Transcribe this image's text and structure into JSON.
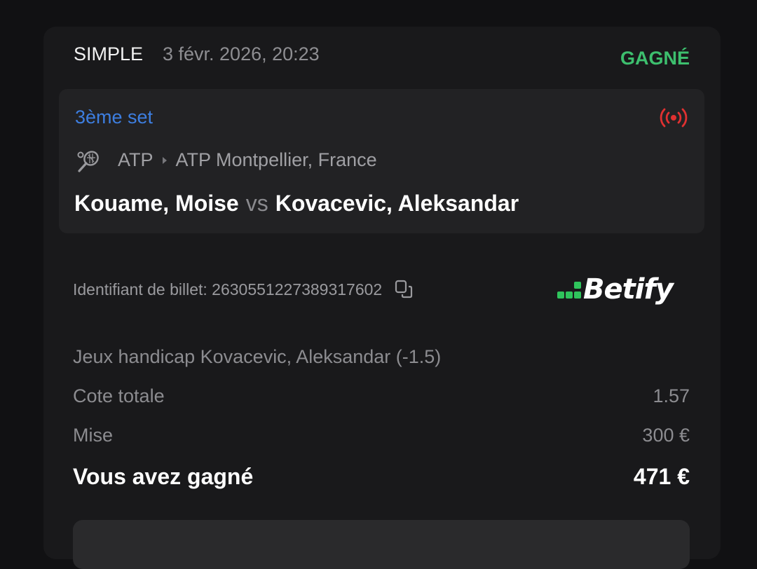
{
  "bet": {
    "type": "SIMPLE",
    "date": "3 févr. 2026, 20:23",
    "status": "GAGNÉ"
  },
  "event": {
    "status": "3ème set",
    "sport_icon": "tennis-icon",
    "live_icon": "live-broadcast-icon",
    "category": "ATP",
    "tournament": "ATP Montpellier, France",
    "home": "Kouame, Moise",
    "vs": "vs",
    "away": "Kovacevic, Aleksandar"
  },
  "ticket": {
    "label": "Identifiant de billet: 2630551227389317602",
    "copy_icon": "copy-icon"
  },
  "brand": {
    "name": "Betify",
    "accent": "#2fc45c"
  },
  "selection": "Jeux handicap Kovacevic, Aleksandar (-1.5)",
  "odds": {
    "label": "Cote totale",
    "value": "1.57"
  },
  "stake": {
    "label": "Mise",
    "value": "300 €"
  },
  "winnings": {
    "label": "Vous avez gagné",
    "value": "471 €"
  },
  "colors": {
    "won": "#3dbf6e",
    "live": "#e03131",
    "link": "#3d7ee0"
  }
}
